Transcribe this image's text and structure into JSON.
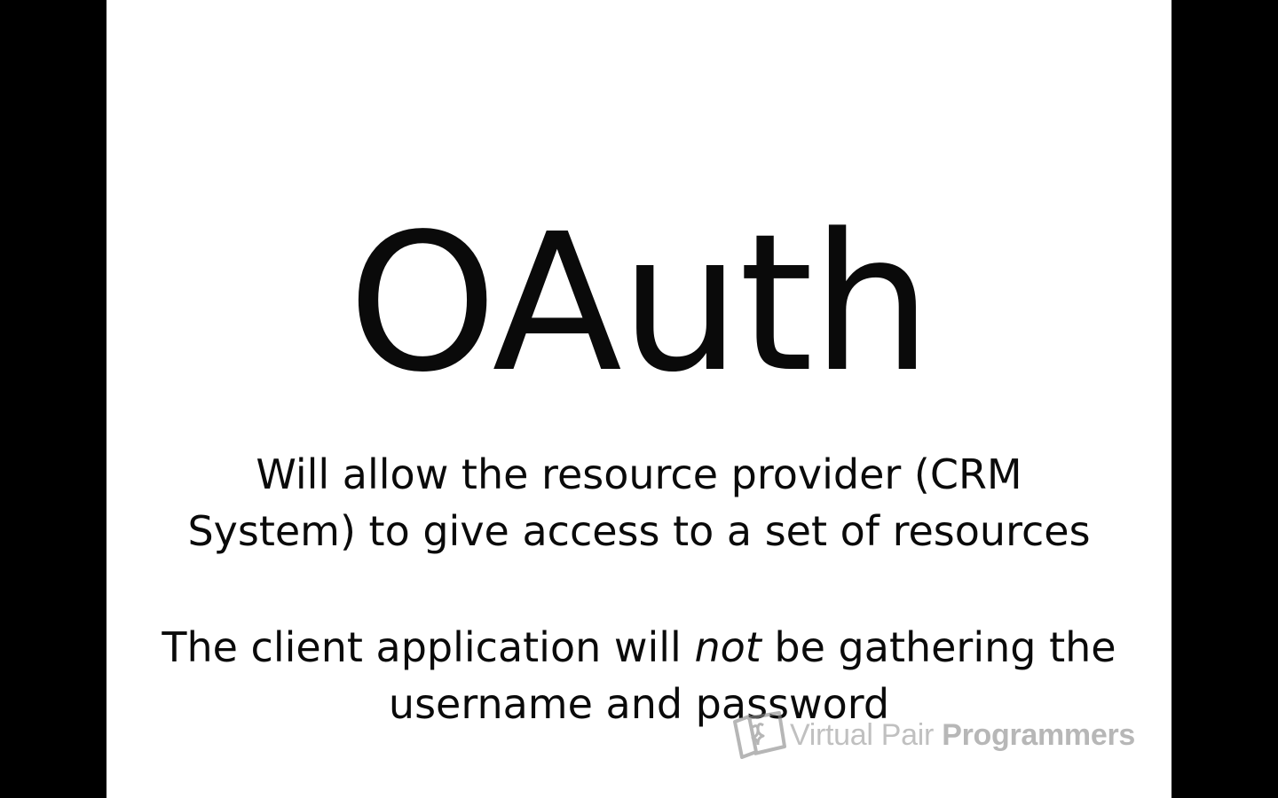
{
  "slide": {
    "title": "OAuth",
    "paragraph_1": {
      "line_1": "Will allow the resource provider (CRM",
      "line_2": "System) to give access to a set of resources"
    },
    "paragraph_2": {
      "line_1_before": "The client application will ",
      "line_1_emphasis": "not",
      "line_1_after": " be gathering the",
      "line_2": "username and password"
    }
  },
  "watermark": {
    "icon": "vpp-logo-icon",
    "text_light": "Virtual Pair ",
    "text_bold": "Programmers"
  },
  "colors": {
    "background": "#000000",
    "slide": "#ffffff",
    "text": "#0a0a0a",
    "watermark": "#8a8a8a"
  }
}
